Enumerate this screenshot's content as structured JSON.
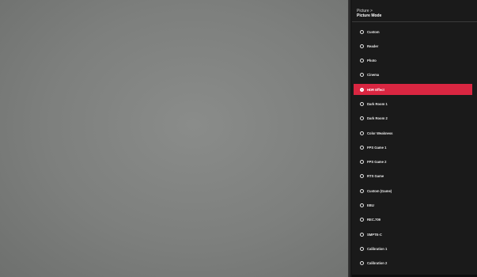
{
  "menu": {
    "breadcrumb": "Picture >",
    "title": "Picture Mode",
    "accent_color": "#d92641",
    "radio_icon": "radio-circle-icon",
    "options": [
      {
        "label": "Custom",
        "selected": false
      },
      {
        "label": "Reader",
        "selected": false
      },
      {
        "label": "Photo",
        "selected": false
      },
      {
        "label": "Cinema",
        "selected": false
      },
      {
        "label": "HDR Effect",
        "selected": true
      },
      {
        "label": "Dark Room 1",
        "selected": false
      },
      {
        "label": "Dark Room 2",
        "selected": false
      },
      {
        "label": "Color Weakness",
        "selected": false
      },
      {
        "label": "FPS Game 1",
        "selected": false
      },
      {
        "label": "FPS Game 2",
        "selected": false
      },
      {
        "label": "RTS Game",
        "selected": false
      },
      {
        "label": "Custom (Game)",
        "selected": false
      },
      {
        "label": "EBU",
        "selected": false
      },
      {
        "label": "REC.709",
        "selected": false
      },
      {
        "label": "SMPTE-C",
        "selected": false
      },
      {
        "label": "Calibration 1",
        "selected": false
      },
      {
        "label": "Calibration 2",
        "selected": false
      }
    ]
  }
}
